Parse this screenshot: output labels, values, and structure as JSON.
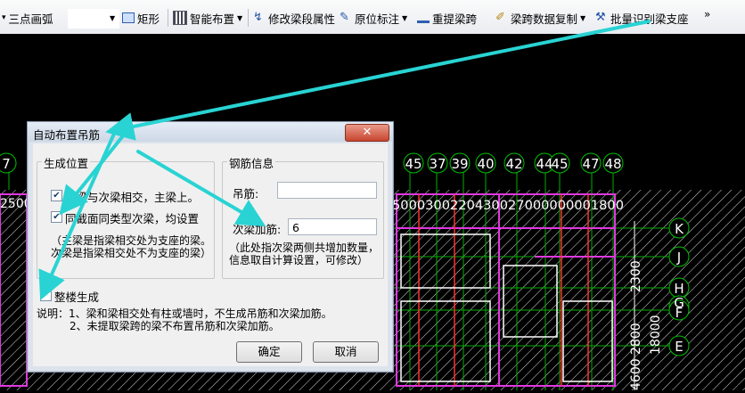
{
  "toolbar": {
    "arc": "三点画弧",
    "rect": "矩形",
    "smart_layout": "智能布置",
    "edit_segment": "修改梁段属性",
    "origin_label": "原位标注",
    "re_extract": "重提梁跨",
    "copy_span": "梁跨数据复制",
    "batch_identify": "批量识别梁支座",
    "more": "»"
  },
  "cad": {
    "top_axes": [
      "7",
      "45",
      "37",
      "39",
      "40",
      "42",
      "44",
      "45",
      "47",
      "48"
    ],
    "right_axes": [
      "K",
      "J",
      "H",
      "G",
      "F",
      "E"
    ],
    "dim_row": "2500",
    "dim_row_right": "5000300220430027000000001800",
    "dim_col_a": "2300",
    "dim_col_b": "2800",
    "dim_col_c": "18000",
    "dim_col_d": "4600"
  },
  "dialog": {
    "title": "自动布置吊筋",
    "close": "✕",
    "position_group": "生成位置",
    "opt1": "主梁与次梁相交，主梁上。",
    "opt2": "同截面同类型次梁，均设置",
    "opt1_checked": true,
    "opt2_checked": true,
    "note1": "（主梁是指梁相交处为支座的梁。",
    "note2": "次梁是指梁相交处不为支座的梁）",
    "rebar_group": "钢筋信息",
    "hanger_label": "吊筋:",
    "hanger_value": "",
    "extra_label": "次梁加筋:",
    "extra_value": "6",
    "info1": "（此处指次梁两侧共增加数量，",
    "info2": "信息取自计算设置，可修改）",
    "whole_floor": "整楼生成",
    "whole_floor_checked": false,
    "explain1": "说明：1、梁和梁相交处有柱或墙时，不生成吊筋和次梁加筋。",
    "explain2": "2、未提取梁跨的梁不布置吊筋和次梁加筋。",
    "ok": "确定",
    "cancel": "取消"
  }
}
